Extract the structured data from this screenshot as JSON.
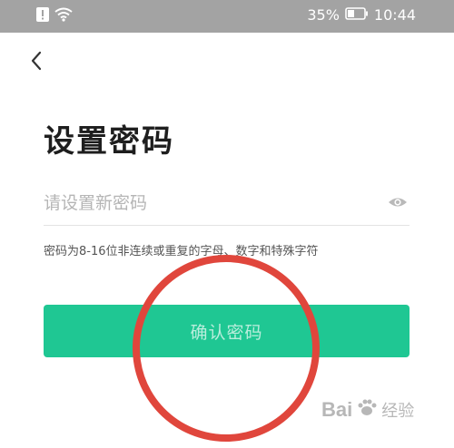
{
  "status_bar": {
    "battery_percent": "35%",
    "time": "10:44"
  },
  "page": {
    "title": "设置密码",
    "password_placeholder": "请设置新密码",
    "password_value": "",
    "hint": "密码为8-16位非连续或重复的字母、数字和特殊字符",
    "confirm_label": "确认密码"
  },
  "icons": {
    "back": "chevron-left-icon",
    "eye": "eye-icon",
    "alert": "alert-icon",
    "wifi": "wifi-icon",
    "battery": "battery-icon"
  },
  "colors": {
    "status_bar": "#a3a3a3",
    "accent": "#1fc793",
    "annotation": "#e0463c"
  },
  "watermark": {
    "brand": "Bai",
    "suffix": "经验"
  }
}
